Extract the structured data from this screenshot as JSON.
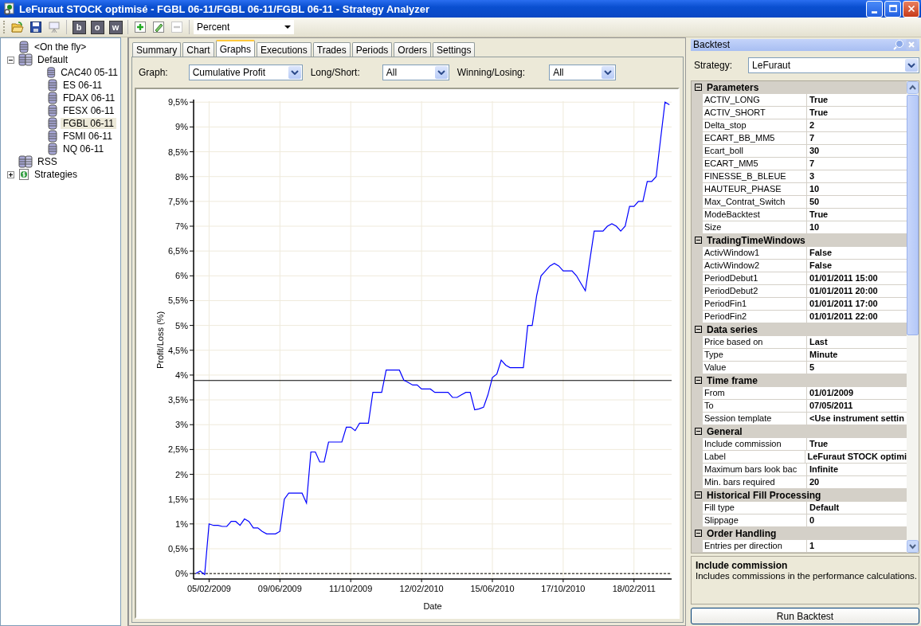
{
  "window": {
    "title": "LeFuraut STOCK optimisé - FGBL 06-11/FGBL 06-11/FGBL 06-11 - Strategy Analyzer"
  },
  "toolbar": {
    "letter_buttons": [
      "b",
      "o",
      "w"
    ],
    "remove_button": {
      "disabled": true
    },
    "unit": "Percent"
  },
  "tree": [
    {
      "label": "<On the fly>",
      "kind": "instrument",
      "selected": false
    },
    {
      "label": "Default",
      "kind": "list",
      "expanded": true,
      "selected": false,
      "children": [
        {
          "label": "CAC40 05-11",
          "kind": "instrument",
          "selected": false
        },
        {
          "label": "ES 06-11",
          "kind": "instrument",
          "selected": false
        },
        {
          "label": "FDAX 06-11",
          "kind": "instrument",
          "selected": false
        },
        {
          "label": "FESX 06-11",
          "kind": "instrument",
          "selected": false
        },
        {
          "label": "FGBL 06-11",
          "kind": "instrument",
          "selected": true
        },
        {
          "label": "FSMI 06-11",
          "kind": "instrument",
          "selected": false
        },
        {
          "label": "NQ 06-11",
          "kind": "instrument",
          "selected": false
        }
      ]
    },
    {
      "label": "RSS",
      "kind": "list",
      "selected": false
    },
    {
      "label": "Strategies",
      "kind": "strategies",
      "expanded": false,
      "selected": false
    }
  ],
  "tabs": [
    {
      "label": "Summary",
      "selected": false
    },
    {
      "label": "Chart",
      "selected": false
    },
    {
      "label": "Graphs",
      "selected": true
    },
    {
      "label": "Executions",
      "selected": false
    },
    {
      "label": "Trades",
      "selected": false
    },
    {
      "label": "Periods",
      "selected": false
    },
    {
      "label": "Orders",
      "selected": false
    },
    {
      "label": "Settings",
      "selected": false
    }
  ],
  "filters": [
    {
      "label": "Graph:",
      "value": "Cumulative Profit"
    },
    {
      "label": "Long/Short:",
      "value": "All"
    },
    {
      "label": "Winning/Losing:",
      "value": "All"
    }
  ],
  "chart": {
    "chart_data": {
      "type": "line",
      "xlabel": "Date",
      "ylabel": "Profit/Loss (%)",
      "grid": true,
      "ylim": [
        -0.11,
        9.52
      ],
      "categories": [
        null,
        null,
        null,
        "05/02/2009",
        null,
        null,
        null,
        null,
        null,
        null,
        null,
        null,
        null,
        null,
        null,
        null,
        null,
        null,
        null,
        "09/06/2009",
        null,
        null,
        null,
        null,
        null,
        null,
        null,
        null,
        null,
        null,
        null,
        null,
        null,
        null,
        null,
        "11/10/2009",
        null,
        null,
        null,
        null,
        null,
        null,
        null,
        null,
        null,
        null,
        null,
        null,
        null,
        null,
        null,
        "12/02/2010",
        null,
        null,
        null,
        null,
        null,
        null,
        null,
        null,
        null,
        null,
        null,
        null,
        null,
        null,
        null,
        "15/06/2010",
        null,
        null,
        null,
        null,
        null,
        null,
        null,
        null,
        null,
        null,
        null,
        null,
        null,
        null,
        null,
        "17/10/2010",
        null,
        null,
        null,
        null,
        null,
        null,
        null,
        null,
        null,
        null,
        null,
        null,
        null,
        null,
        null,
        "18/02/2011",
        null,
        null,
        null,
        null,
        null,
        null,
        null,
        null
      ],
      "yticks": [
        {
          "value": 0,
          "label": "0%"
        },
        {
          "value": 0.5,
          "label": "0,5%"
        },
        {
          "value": 1,
          "label": "1%"
        },
        {
          "value": 1.5,
          "label": "1,5%"
        },
        {
          "value": 2,
          "label": "2%"
        },
        {
          "value": 2.5,
          "label": "2,5%"
        },
        {
          "value": 3,
          "label": "3%"
        },
        {
          "value": 3.5,
          "label": "3,5%"
        },
        {
          "value": 4,
          "label": "4%"
        },
        {
          "value": 4.5,
          "label": "4,5%"
        },
        {
          "value": 5,
          "label": "5%"
        },
        {
          "value": 5.5,
          "label": "5,5%"
        },
        {
          "value": 6,
          "label": "6%"
        },
        {
          "value": 6.5,
          "label": "6,5%"
        },
        {
          "value": 7,
          "label": "7%"
        },
        {
          "value": 7.5,
          "label": "7,5%"
        },
        {
          "value": 8,
          "label": "8%"
        },
        {
          "value": 8.5,
          "label": "8,5%"
        },
        {
          "value": 9,
          "label": "9%"
        },
        {
          "value": 9.5,
          "label": "9,5%"
        }
      ],
      "series": [
        {
          "color": "#0000ff",
          "values": [
            0,
            0.05,
            -0.02,
            1.0,
            0.97,
            0.97,
            0.95,
            0.95,
            1.05,
            1.05,
            0.97,
            1.1,
            1.05,
            0.92,
            0.92,
            0.85,
            0.8,
            0.8,
            0.8,
            0.85,
            1.5,
            1.62,
            1.62,
            1.62,
            1.62,
            1.42,
            2.45,
            2.45,
            2.25,
            2.25,
            2.65,
            2.65,
            2.65,
            2.65,
            2.95,
            2.95,
            2.88,
            3.03,
            3.03,
            3.03,
            3.65,
            3.65,
            3.65,
            4.1,
            4.1,
            4.1,
            4.1,
            3.9,
            3.85,
            3.8,
            3.8,
            3.72,
            3.72,
            3.72,
            3.65,
            3.65,
            3.65,
            3.65,
            3.55,
            3.55,
            3.6,
            3.65,
            3.65,
            3.3,
            3.32,
            3.35,
            3.6,
            3.95,
            4.02,
            4.3,
            4.2,
            4.15,
            4.15,
            4.15,
            4.15,
            5.0,
            5.0,
            5.6,
            6.0,
            6.1,
            6.2,
            6.25,
            6.2,
            6.1,
            6.1,
            6.1,
            6.0,
            5.85,
            5.7,
            6.3,
            6.9,
            6.9,
            6.9,
            7.0,
            7.05,
            7.0,
            6.9,
            7.0,
            7.4,
            7.4,
            7.5,
            7.5,
            7.9,
            7.9,
            8.0,
            8.75,
            9.5,
            9.45
          ]
        }
      ],
      "ref_lines": [
        {
          "axis": "y",
          "value": 3.89
        },
        {
          "axis": "y",
          "value": 0
        }
      ]
    }
  },
  "backtest": {
    "title": "Backtest",
    "strategy_label": "Strategy:",
    "strategy": "LeFuraut",
    "categories": [
      {
        "name": "Parameters",
        "expanded": true,
        "rows": [
          {
            "name": "ACTIV_LONG",
            "value": "True"
          },
          {
            "name": "ACTIV_SHORT",
            "value": "True"
          },
          {
            "name": "Delta_stop",
            "value": "2"
          },
          {
            "name": "ECART_BB_MM5",
            "value": "7"
          },
          {
            "name": "Ecart_boll",
            "value": "30"
          },
          {
            "name": "ECART_MM5",
            "value": "7"
          },
          {
            "name": "FINESSE_B_BLEUE",
            "value": "3"
          },
          {
            "name": "HAUTEUR_PHASE",
            "value": "10"
          },
          {
            "name": "Max_Contrat_Switch",
            "value": "50"
          },
          {
            "name": "ModeBacktest",
            "value": "True"
          },
          {
            "name": "Size",
            "value": "10"
          }
        ]
      },
      {
        "name": "TradingTimeWindows",
        "expanded": true,
        "rows": [
          {
            "name": "ActivWindow1",
            "value": "False"
          },
          {
            "name": "ActivWindow2",
            "value": "False"
          },
          {
            "name": "PeriodDebut1",
            "value": "01/01/2011 15:00"
          },
          {
            "name": "PeriodDebut2",
            "value": "01/01/2011 20:00"
          },
          {
            "name": "PeriodFin1",
            "value": "01/01/2011 17:00"
          },
          {
            "name": "PeriodFin2",
            "value": "01/01/2011 22:00"
          }
        ]
      },
      {
        "name": "Data series",
        "expanded": true,
        "rows": [
          {
            "name": "Price based on",
            "value": "Last"
          },
          {
            "name": "Type",
            "value": "Minute"
          },
          {
            "name": "Value",
            "value": "5"
          }
        ]
      },
      {
        "name": "Time frame",
        "expanded": true,
        "rows": [
          {
            "name": "From",
            "value": "01/01/2009"
          },
          {
            "name": "To",
            "value": "07/05/2011"
          },
          {
            "name": "Session template",
            "value": "<Use instrument settin"
          }
        ]
      },
      {
        "name": "General",
        "expanded": true,
        "rows": [
          {
            "name": "Include commission",
            "value": "True"
          },
          {
            "name": "Label",
            "value": "LeFuraut STOCK optimi"
          },
          {
            "name": "Maximum bars look bac",
            "value": "Infinite"
          },
          {
            "name": "Min. bars required",
            "value": "20"
          }
        ]
      },
      {
        "name": "Historical Fill Processing",
        "expanded": true,
        "rows": [
          {
            "name": "Fill type",
            "value": "Default"
          },
          {
            "name": "Slippage",
            "value": "0"
          }
        ]
      },
      {
        "name": "Order Handling",
        "expanded": true,
        "rows": [
          {
            "name": "Entries per direction",
            "value": "1"
          }
        ]
      }
    ],
    "description": {
      "title": "Include commission",
      "text": "Includes commissions in the performance calculations."
    },
    "run_button": "Run Backtest"
  }
}
